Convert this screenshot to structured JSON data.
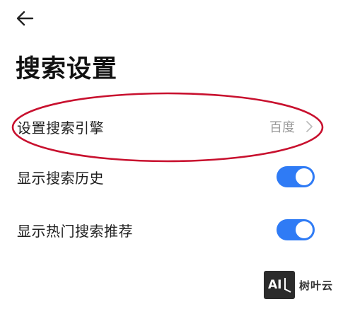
{
  "header": {
    "back_icon": "arrow-left-icon",
    "title": "搜索设置"
  },
  "settings": {
    "search_engine": {
      "label": "设置搜索引擎",
      "value": "百度",
      "icon": "chevron-right-icon"
    },
    "show_history": {
      "label": "显示搜索历史",
      "enabled": true
    },
    "show_hot": {
      "label": "显示热门搜索推荐",
      "enabled": true
    }
  },
  "annotation": {
    "shape": "ellipse",
    "color": "#c8102e"
  },
  "watermark": {
    "logo_text": "AI",
    "text": "树叶云"
  },
  "colors": {
    "accent": "#2f7bf5",
    "value_gray": "#9a9a9a",
    "title": "#111111"
  }
}
